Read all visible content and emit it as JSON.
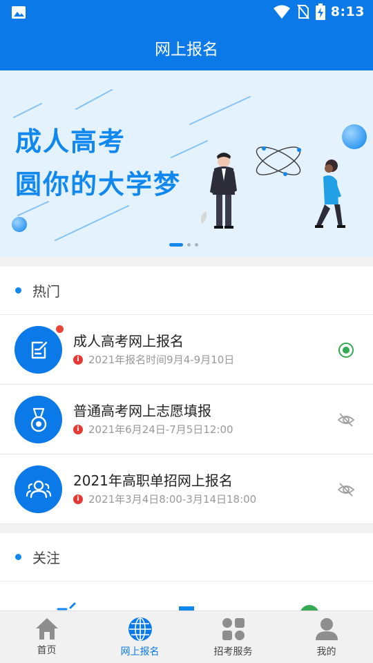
{
  "status_bar": {
    "time": "8:13"
  },
  "app_bar": {
    "title": "网上报名"
  },
  "banner": {
    "line1": "成人高考",
    "line2": "圆你的大学梦",
    "page_count": 3,
    "active_page": 1
  },
  "hot": {
    "title": "热门",
    "items": [
      {
        "title": "成人高考网上报名",
        "subtitle": "2021年报名时间9月4-9月10日",
        "status": "active",
        "has_badge": true,
        "icon": "edit-note-icon",
        "info": "i"
      },
      {
        "title": "普通高考网上志愿填报",
        "subtitle": "2021年6月24日-7月5日12:00",
        "status": "hidden",
        "has_badge": false,
        "icon": "medal-icon",
        "info": "i"
      },
      {
        "title": "2021年高职单招网上报名",
        "subtitle": "2021年3月4日8:00-3月14日18:00",
        "status": "hidden",
        "has_badge": false,
        "icon": "group-icon",
        "info": "i"
      }
    ]
  },
  "follow": {
    "title": "关注"
  },
  "tabs": [
    {
      "label": "首页",
      "icon": "home-icon",
      "active": false
    },
    {
      "label": "网上报名",
      "icon": "globe-icon",
      "active": true
    },
    {
      "label": "招考服务",
      "icon": "services-icon",
      "active": false
    },
    {
      "label": "我的",
      "icon": "person-icon",
      "active": false
    }
  ],
  "colors": {
    "primary": "#0b7ae8",
    "active_status": "#34a853",
    "badge": "#ea4335"
  }
}
